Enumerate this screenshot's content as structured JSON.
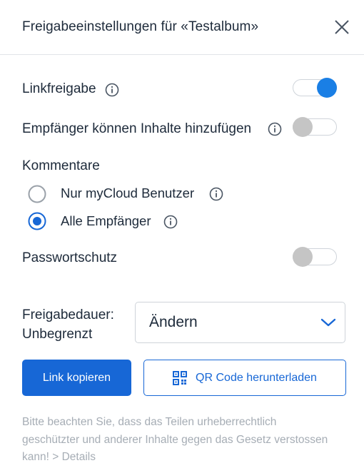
{
  "dialog": {
    "title": "Freigabeeinstellungen für «Testalbum»",
    "close_icon": "close-icon"
  },
  "settings": {
    "link_sharing": {
      "label": "Linkfreigabe",
      "enabled": true
    },
    "recipients_add": {
      "label": "Empfänger können Inhalte hinzufügen",
      "enabled": false
    },
    "comments": {
      "heading": "Kommentare",
      "options": [
        {
          "label": "Nur myCloud Benutzer",
          "selected": false
        },
        {
          "label": "Alle Empfänger",
          "selected": true
        }
      ]
    },
    "password": {
      "label": "Passwortschutz",
      "enabled": false
    }
  },
  "duration": {
    "label_line1": "Freigabedauer:",
    "label_line2": "Unbegrenzt",
    "select_value": "Ändern"
  },
  "actions": {
    "copy_link": "Link kopieren",
    "qr_download": "QR Code herunterladen"
  },
  "notice": {
    "text": "Bitte beachten Sie, dass das Teilen urheberrechtlich geschützter und anderer Inhalte gegen das Gesetz verstossen kann! ",
    "link": "> Details"
  },
  "colors": {
    "accent": "#1767d6",
    "toggle_on": "#1a7fe5",
    "toggle_off": "#c5c5c5",
    "muted_text": "#a6adb5"
  }
}
